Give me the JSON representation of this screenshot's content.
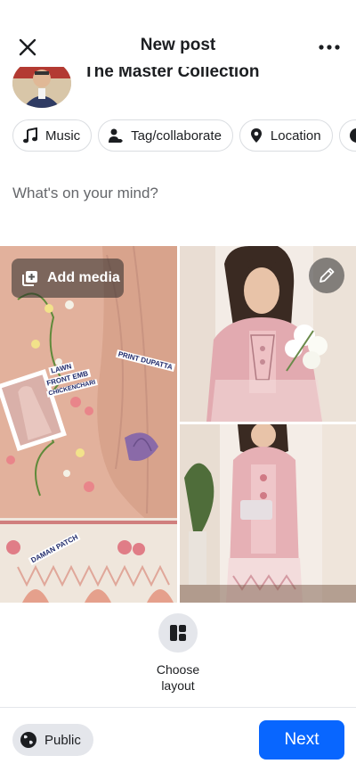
{
  "header": {
    "title": "New post",
    "close_icon": "close-icon",
    "more_icon": "more-dots-icon"
  },
  "author": {
    "name": "The Master Collection"
  },
  "chips": [
    {
      "label": "Music",
      "icon": "music-note-icon"
    },
    {
      "label": "Tag/collaborate",
      "icon": "tag-people-icon"
    },
    {
      "label": "Location",
      "icon": "location-pin-icon"
    }
  ],
  "composer": {
    "placeholder": "What's on your mind?"
  },
  "media": {
    "add_media_label": "Add media",
    "edit_icon": "pencil-icon",
    "fabric_labels": [
      "LAWN",
      "FRONT EMB",
      "CHICKENCHARI",
      "PRINT DUPATTA",
      "DAMAN PATCH"
    ]
  },
  "layout": {
    "label_line1": "Choose",
    "label_line2": "layout"
  },
  "footer": {
    "audience_label": "Public",
    "next_label": "Next"
  },
  "colors": {
    "accent": "#0866ff",
    "chip_border": "#dadde1",
    "muted_text": "#65676b",
    "fabric_peach": "#e6b5a0"
  }
}
